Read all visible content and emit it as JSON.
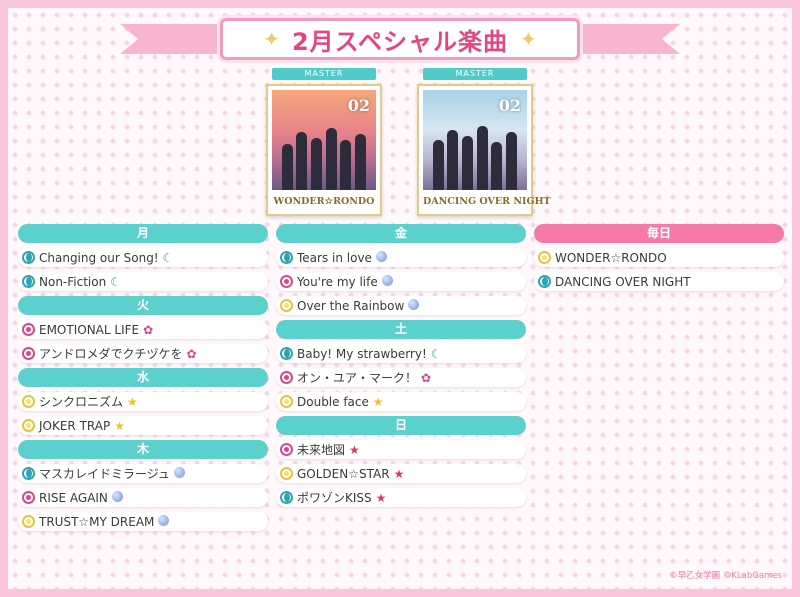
{
  "banner": {
    "title": "2月スペシャル楽曲",
    "sparkle": "✦"
  },
  "albums": [
    {
      "tag": "MASTER",
      "logo": "02",
      "name": "WONDER☆RONDO"
    },
    {
      "tag": "MASTER",
      "logo": "02",
      "name": "DANCING OVER NIGHT"
    }
  ],
  "columns": [
    [
      {
        "day": "月",
        "songs": [
          {
            "attr": "moon",
            "title": "Changing our Song!",
            "trail": "moon"
          },
          {
            "attr": "moon",
            "title": "Non-Fiction",
            "trail": "moon"
          }
        ]
      },
      {
        "day": "火",
        "songs": [
          {
            "attr": "flower",
            "title": "EMOTIONAL LIFE",
            "trail": "flower"
          },
          {
            "attr": "flower",
            "title": "アンドロメダでクチヅケを",
            "trail": "flower"
          }
        ]
      },
      {
        "day": "水",
        "songs": [
          {
            "attr": "sun",
            "title": "シンクロニズム",
            "trail": "star"
          },
          {
            "attr": "sun",
            "title": "JOKER TRAP",
            "trail": "star"
          }
        ]
      },
      {
        "day": "木",
        "songs": [
          {
            "attr": "moon",
            "title": "マスカレイドミラージュ",
            "trail": "orb"
          },
          {
            "attr": "flower",
            "title": "RISE AGAIN",
            "trail": "orb"
          },
          {
            "attr": "sun",
            "title": "TRUST☆MY DREAM",
            "trail": "orb"
          }
        ]
      }
    ],
    [
      {
        "day": "金",
        "songs": [
          {
            "attr": "moon",
            "title": "Tears in love",
            "trail": "orb"
          },
          {
            "attr": "flower",
            "title": "You're my life",
            "trail": "orb"
          },
          {
            "attr": "sun",
            "title": "Over the Rainbow",
            "trail": "orb"
          }
        ]
      },
      {
        "day": "土",
        "songs": [
          {
            "attr": "moon",
            "title": "Baby! My strawberry!",
            "trail": "moon"
          },
          {
            "attr": "flower",
            "title": "オン・ユア・マーク！",
            "trail": "flower"
          },
          {
            "attr": "sun",
            "title": "Double face",
            "trail": "star"
          }
        ]
      },
      {
        "day": "日",
        "songs": [
          {
            "attr": "flower",
            "title": "未来地図",
            "trail": "redstar"
          },
          {
            "attr": "sun",
            "title": "GOLDEN☆STAR",
            "trail": "redstar"
          },
          {
            "attr": "moon",
            "title": "ポワゾンKISS",
            "trail": "redstar"
          }
        ]
      }
    ],
    [
      {
        "day": "毎日",
        "pink": true,
        "songs": [
          {
            "attr": "sun",
            "title": "WONDER☆RONDO",
            "trail": ""
          },
          {
            "attr": "moon",
            "title": "DANCING OVER NIGHT",
            "trail": ""
          }
        ]
      }
    ]
  ],
  "copyright": "©早乙女学園 ©KLabGames",
  "colors": {
    "day_teal": "#5cd0cd",
    "day_pink": "#f57aa7",
    "banner_text": "#e7457f",
    "frame": "#f9c6dc"
  }
}
